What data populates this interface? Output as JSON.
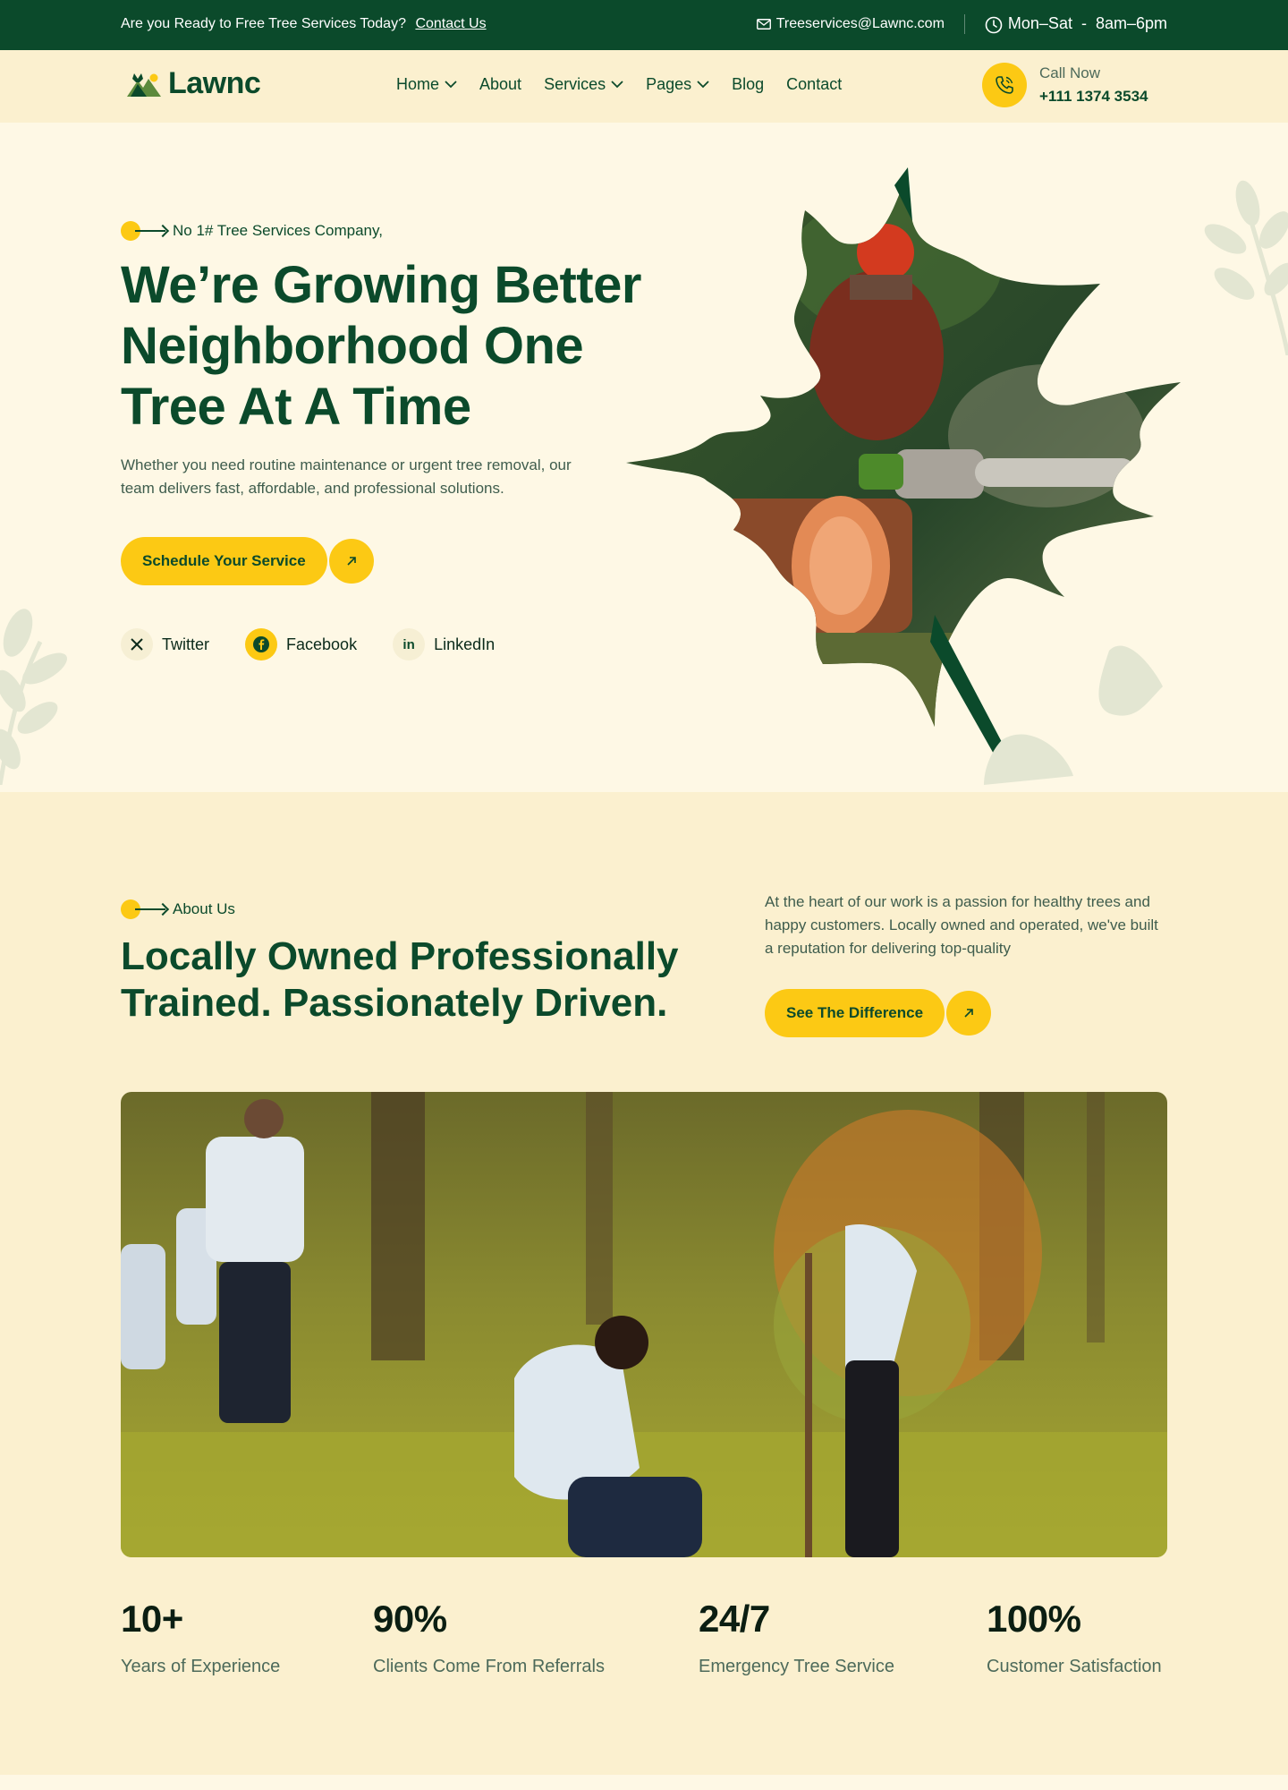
{
  "topbar": {
    "promo": "Are you Ready to Free Tree Services Today?",
    "promo_link": "Contact Us",
    "email": "Treeservices@Lawnc.com",
    "hours": "Mon–Sat  -  8am–6pm"
  },
  "header": {
    "logo": "Lawnc",
    "nav": [
      "Home",
      "About",
      "Services",
      "Pages",
      "Blog",
      "Contact"
    ],
    "call_label": "Call Now",
    "call_number": "+111 1374 3534"
  },
  "hero": {
    "eyebrow": "No 1# Tree Services Company,",
    "title": "We’re Growing Better Neighborhood One Tree At A Time",
    "description": "Whether you need routine maintenance or urgent tree removal, our team delivers fast, affordable, and professional solutions.",
    "cta": "Schedule Your Service",
    "socials": [
      "Twitter",
      "Facebook",
      "LinkedIn"
    ]
  },
  "about": {
    "eyebrow": "About Us",
    "title": "Locally Owned Professionally Trained. Passionately Driven.",
    "description": "At the heart of our work is a passion for healthy trees and happy customers. Locally owned and operated, we've built a reputation for delivering top-quality",
    "cta": "See The Difference",
    "stats": [
      {
        "value": "10+",
        "label": "Years of Experience"
      },
      {
        "value": "90%",
        "label": "Clients Come From Referrals"
      },
      {
        "value": "24/7",
        "label": "Emergency Tree Service"
      },
      {
        "value": "100%",
        "label": "Customer Satisfaction"
      }
    ]
  },
  "colors": {
    "brand_green": "#0b4a2b",
    "accent_yellow": "#fcc914",
    "cream": "#fef8e5",
    "sand": "#fbf0cf"
  }
}
